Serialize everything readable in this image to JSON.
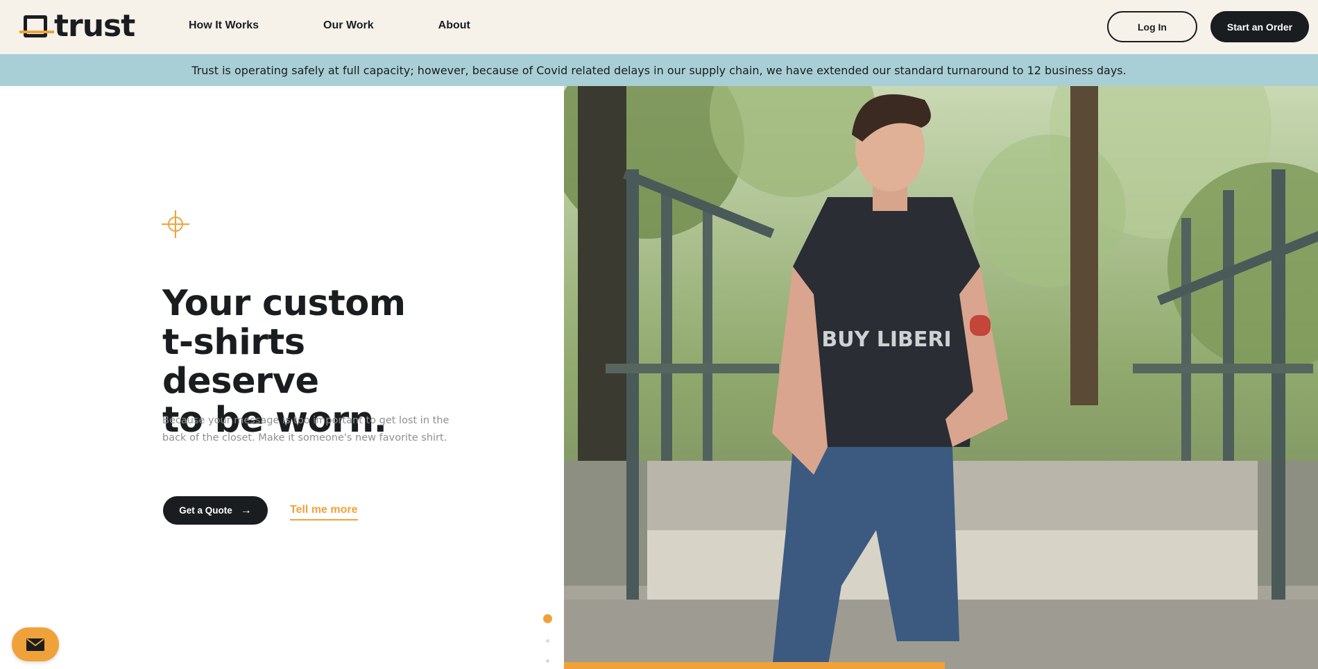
{
  "header": {
    "logo_text": "trust",
    "nav": [
      "How It Works",
      "Our Work",
      "About"
    ],
    "login_label": "Log In",
    "start_order_label": "Start an Order"
  },
  "banner": {
    "text": "Trust is operating safely at full capacity; however, because of Covid related delays in our supply chain, we have extended our standard turnaround to 12 business days."
  },
  "hero": {
    "title_lines": [
      "Your custom",
      "t-shirts deserve",
      "to be worn."
    ],
    "subtitle_lines": [
      "Because your message is too important to get lost in the",
      "back of the closet. Make it someone's new favorite shirt."
    ],
    "quote_button": "Get a Quote",
    "more_link": "Tell me more",
    "slider": {
      "total": 3,
      "active": 1,
      "progress": 0.505
    },
    "photo_shirt_text": "BUY LIBERI"
  },
  "colors": {
    "accent": "#f0a23a",
    "dark": "#1a1d1f",
    "header_bg": "#f6f2ea",
    "banner_bg": "#a9cfd6"
  },
  "icons": {
    "crosshair": "crosshair-icon",
    "chat": "envelope-icon",
    "arrow": "arrow-right-icon"
  }
}
